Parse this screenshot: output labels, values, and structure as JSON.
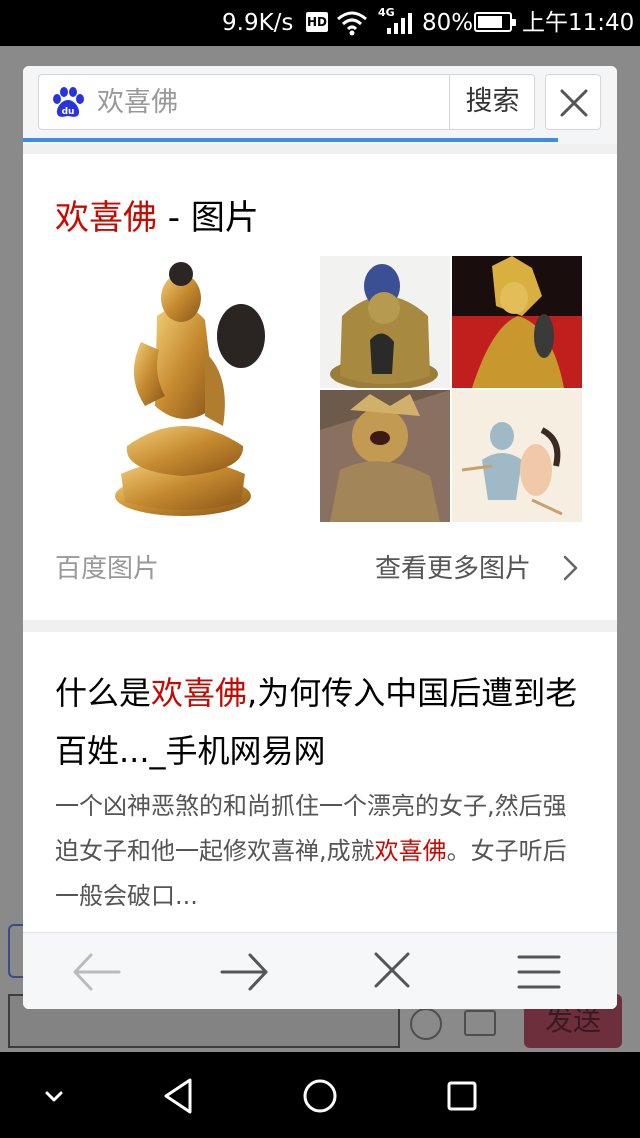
{
  "status_bar": {
    "network_speed": "9.9K/s",
    "hd_label": "HD",
    "network_type": "4G",
    "battery_percent": "80%",
    "battery_level": 0.8,
    "time": "上午11:40"
  },
  "background_app": {
    "send_label": "发送"
  },
  "popup": {
    "search": {
      "query": "欢喜佛",
      "button_label": "搜索"
    },
    "image_card": {
      "title_highlight": "欢喜佛",
      "title_rest": " - 图片",
      "source_label": "百度图片",
      "more_label": "查看更多图片"
    },
    "result": {
      "title_before": "什么是",
      "title_highlight": "欢喜佛",
      "title_after": ",为何传入中国后遭到老百姓..._手机网易网",
      "desc_before": "一个凶神恶煞的和尚抓住一个漂亮的女子,然后强迫女子和他一起修欢喜禅,成就",
      "desc_highlight": "欢喜佛",
      "desc_after": "。女子听后一般会破口..."
    }
  },
  "colors": {
    "highlight": "#c60a00",
    "progress": "#3f8ce8",
    "baidu_blue": "#2932e1"
  }
}
